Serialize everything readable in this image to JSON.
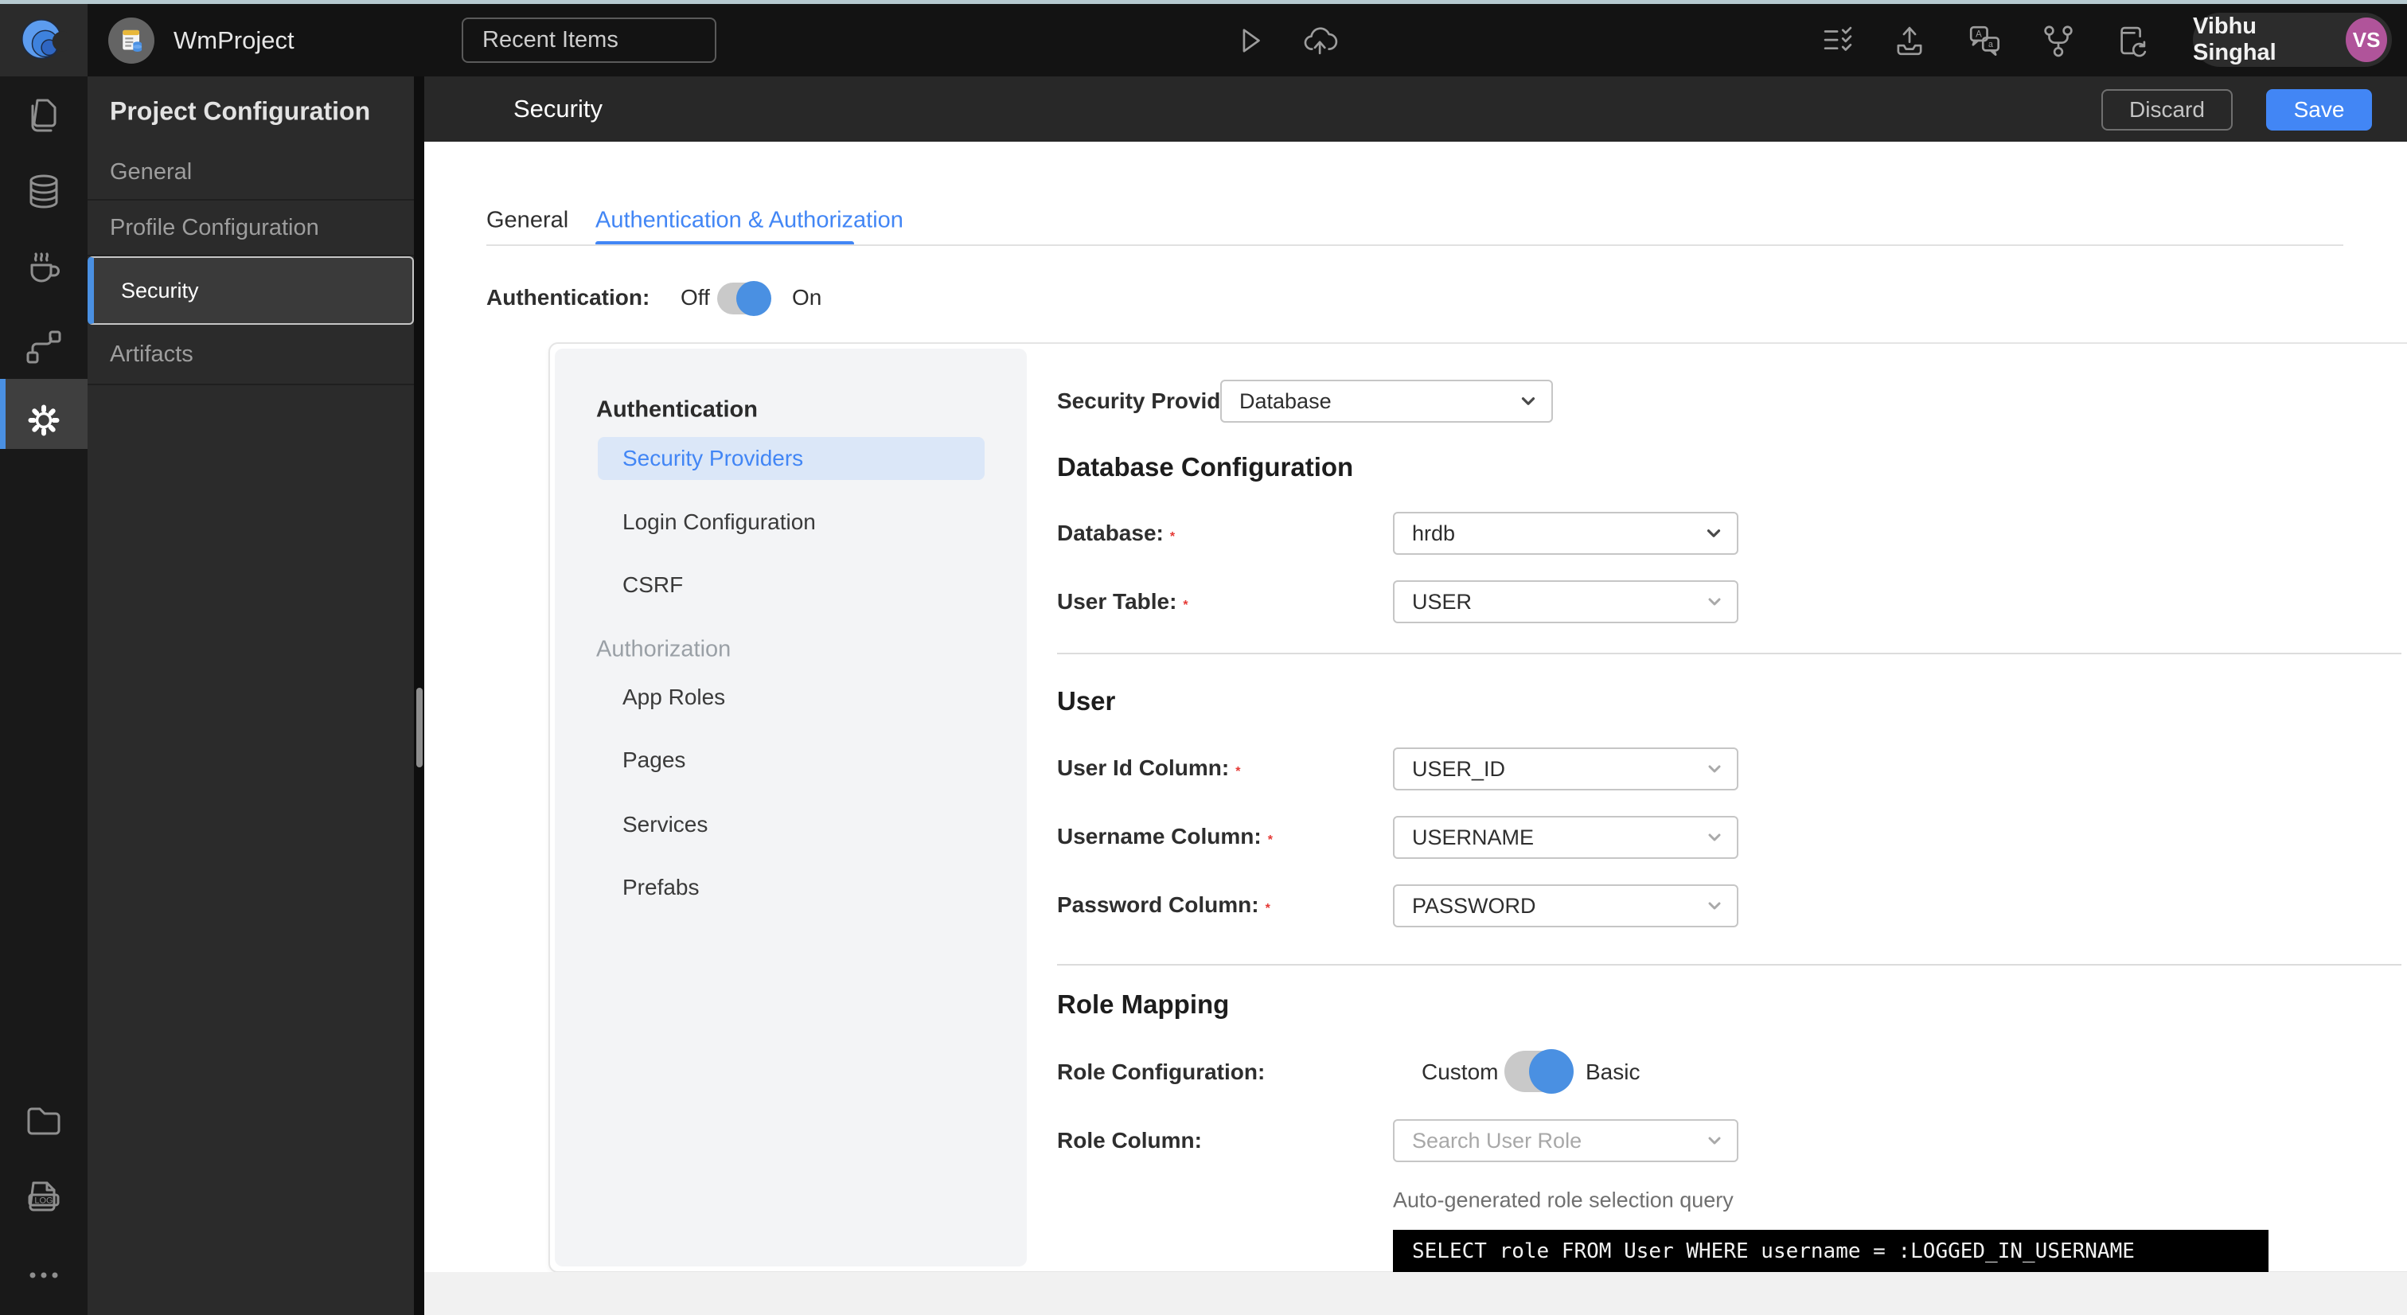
{
  "topbar": {
    "project_name": "WmProject",
    "recent_items": "Recent Items",
    "user": {
      "name": "Vibhu Singhal",
      "initials": "VS"
    }
  },
  "rail": {
    "log_label": "LOG"
  },
  "project_config": {
    "title": "Project Configuration",
    "items": [
      {
        "label": "General"
      },
      {
        "label": "Profile Configuration"
      },
      {
        "label": "Security"
      },
      {
        "label": "Artifacts"
      }
    ]
  },
  "page": {
    "title": "Security",
    "discard": "Discard",
    "save": "Save"
  },
  "tabs": {
    "general": "General",
    "auth": "Authentication & Authorization"
  },
  "authentication_toggle": {
    "label": "Authentication:",
    "off": "Off",
    "on": "On",
    "state": "on"
  },
  "subnav": {
    "auth_heading": "Authentication",
    "auth_items": [
      "Security Providers",
      "Login Configuration",
      "CSRF"
    ],
    "authz_heading": "Authorization",
    "authz_items": [
      "App Roles",
      "Pages",
      "Services",
      "Prefabs"
    ]
  },
  "form": {
    "required_marker": "*",
    "security_provider": {
      "label": "Security Provider",
      "value": "Database"
    },
    "database_section": {
      "heading": "Database Configuration",
      "database": {
        "label": "Database:",
        "value": "hrdb"
      },
      "user_table": {
        "label": "User Table:",
        "value": "USER"
      }
    },
    "user_section": {
      "heading": "User",
      "user_id": {
        "label": "User Id Column:",
        "value": "USER_ID"
      },
      "username": {
        "label": "Username Column:",
        "value": "USERNAME"
      },
      "password": {
        "label": "Password Column:",
        "value": "PASSWORD"
      }
    },
    "role_section": {
      "heading": "Role Mapping",
      "role_configuration": {
        "label": "Role Configuration:",
        "left": "Custom",
        "right": "Basic",
        "state": "basic"
      },
      "role_column": {
        "label": "Role Column:",
        "placeholder": "Search User Role"
      },
      "query_caption": "Auto-generated role selection query",
      "query": "SELECT role FROM User WHERE username = :LOGGED_IN_USERNAME"
    }
  },
  "colors": {
    "accent": "#4286f5",
    "toggle_knob": "#4a90e2",
    "required": "#e53935",
    "selected_pill": "#dbe7f8"
  }
}
